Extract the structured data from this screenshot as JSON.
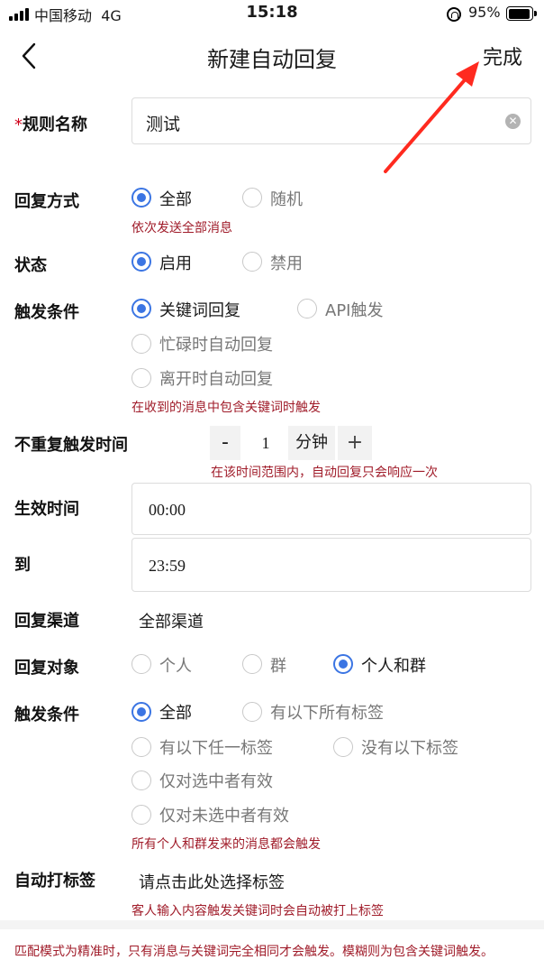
{
  "status_bar": {
    "carrier": "中国移动",
    "network": "4G",
    "time": "15:18",
    "battery": "95%"
  },
  "nav": {
    "title": "新建自动回复",
    "done_label": "完成"
  },
  "rule_name": {
    "required_mark": "*",
    "label": "规则名称",
    "value": "测试",
    "clear_icon": "clear-icon"
  },
  "reply_mode": {
    "label": "回复方式",
    "options": [
      "全部",
      "随机"
    ],
    "selected": "全部",
    "hint": "依次发送全部消息"
  },
  "status": {
    "label": "状态",
    "options": [
      "启用",
      "禁用"
    ],
    "selected": "启用"
  },
  "trigger": {
    "label": "触发条件",
    "options": [
      "关键词回复",
      "API触发",
      "忙碌时自动回复",
      "离开时自动回复"
    ],
    "selected": "关键词回复",
    "hint": "在收到的消息中包含关键词时触发"
  },
  "no_repeat": {
    "label": "不重复触发时间",
    "minus": "-",
    "value": "1",
    "unit": "分钟",
    "plus": "+",
    "hint": "在该时间范围内，自动回复只会响应一次"
  },
  "effective_time": {
    "label": "生效时间",
    "start": "00:00",
    "to_label": "到",
    "end": "23:59"
  },
  "channel": {
    "label": "回复渠道",
    "value": "全部渠道"
  },
  "target": {
    "label": "回复对象",
    "options": [
      "个人",
      "群",
      "个人和群"
    ],
    "selected": "个人和群"
  },
  "tag_condition": {
    "label": "触发条件",
    "options": [
      "全部",
      "有以下所有标签",
      "有以下任一标签",
      "没有以下标签",
      "仅对选中者有效",
      "仅对未选中者有效"
    ],
    "selected": "全部",
    "hint": "所有个人和群发来的消息都会触发"
  },
  "auto_tag": {
    "label": "自动打标签",
    "placeholder": "请点击此处选择标签",
    "hint": "客人输入内容触发关键词时会自动被打上标签"
  },
  "footer_note": "匹配模式为精准时，只有消息与关键词完全相同才会触发。模糊则为包含关键词触发。",
  "colors": {
    "accent": "#3b75e3",
    "hint": "#a01c2a",
    "arrow": "#ff2a1f"
  }
}
